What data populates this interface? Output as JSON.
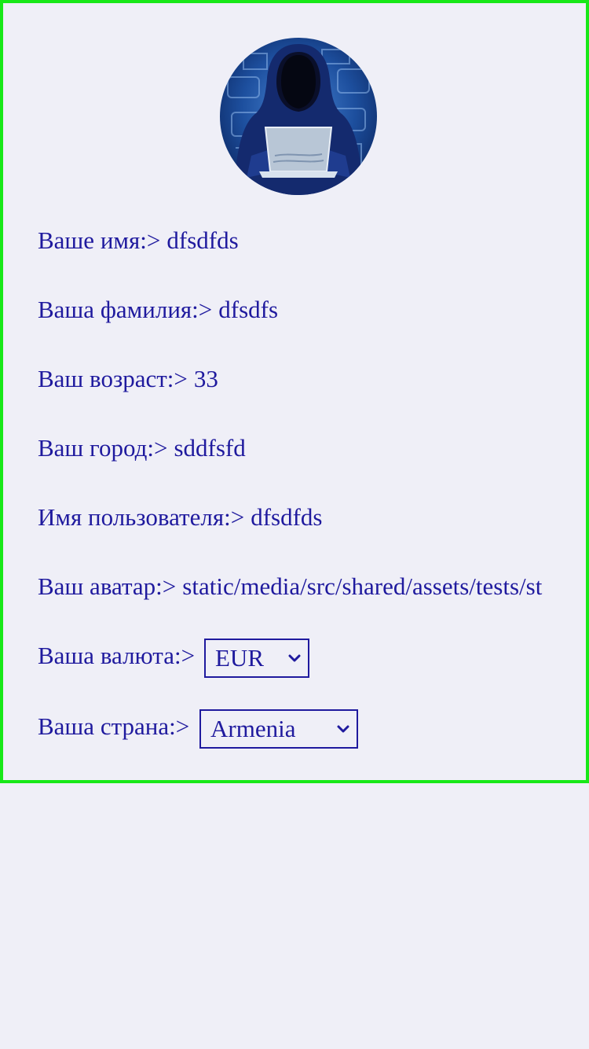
{
  "profile": {
    "avatar_icon": "hooded-hacker-avatar",
    "fields": [
      {
        "label": "Ваше имя:>",
        "value": "dfsdfds"
      },
      {
        "label": "Ваша фамилия:>",
        "value": "dfsdfs"
      },
      {
        "label": "Ваш возраст:>",
        "value": "33"
      },
      {
        "label": "Ваш город:>",
        "value": "sddfsfd"
      },
      {
        "label": "Имя пользователя:>",
        "value": "dfsdfds"
      },
      {
        "label": "Ваш аватар:>",
        "value": "static/media/src/shared/assets/tests/st"
      }
    ],
    "currency": {
      "label": "Ваша валюта:>",
      "selected": "EUR"
    },
    "country": {
      "label": "Ваша страна:>",
      "selected": "Armenia"
    }
  },
  "colors": {
    "text": "#1f1a9e",
    "border": "#18e818",
    "background": "#efeff7"
  }
}
